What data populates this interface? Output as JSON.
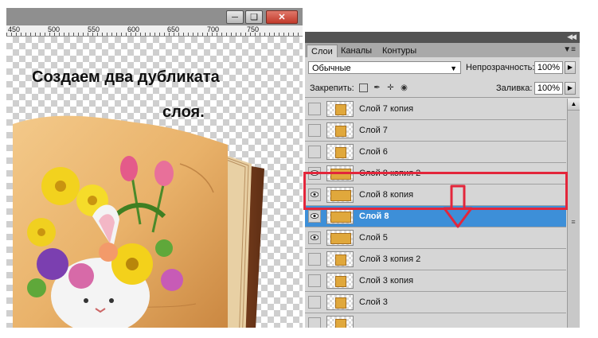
{
  "document": {
    "ruler_ticks": [
      "450",
      "500",
      "550",
      "600",
      "650",
      "700",
      "750"
    ],
    "caption_line1": "Создаем два дубликата",
    "caption_line2": "слоя.",
    "window_buttons": [
      "minimize-icon",
      "restore-icon",
      "close-icon"
    ]
  },
  "panel": {
    "collapse_icon": "double-chevron-icon",
    "tabs": [
      "Слои",
      "Каналы",
      "Контуры"
    ],
    "active_tab": "Слои",
    "blend_mode": "Обычные",
    "opacity_label": "Непрозрачность:",
    "opacity_value": "100%",
    "lock_label": "Закрепить:",
    "lock_icons": [
      "lock-transparent-icon",
      "lock-brush-icon",
      "lock-move-icon",
      "lock-all-icon"
    ],
    "fill_label": "Заливка:",
    "fill_value": "100%",
    "layers": [
      {
        "name": "Слой 7 копия",
        "visible": false,
        "selected": false
      },
      {
        "name": "Слой 7",
        "visible": false,
        "selected": false
      },
      {
        "name": "Слой 6",
        "visible": false,
        "selected": false
      },
      {
        "name": "Слой 8 копия 2",
        "visible": true,
        "selected": false
      },
      {
        "name": "Слой 8 копия",
        "visible": true,
        "selected": false
      },
      {
        "name": "Слой 8",
        "visible": true,
        "selected": true
      },
      {
        "name": "Слой 5",
        "visible": true,
        "selected": false
      },
      {
        "name": "Слой 3 копия 2",
        "visible": false,
        "selected": false
      },
      {
        "name": "Слой 3 копия",
        "visible": false,
        "selected": false
      },
      {
        "name": "Слой 3",
        "visible": false,
        "selected": false
      },
      {
        "name": "",
        "visible": false,
        "selected": false
      }
    ]
  },
  "colors": {
    "selection": "#3d8fd8",
    "highlight": "#e3263b"
  }
}
